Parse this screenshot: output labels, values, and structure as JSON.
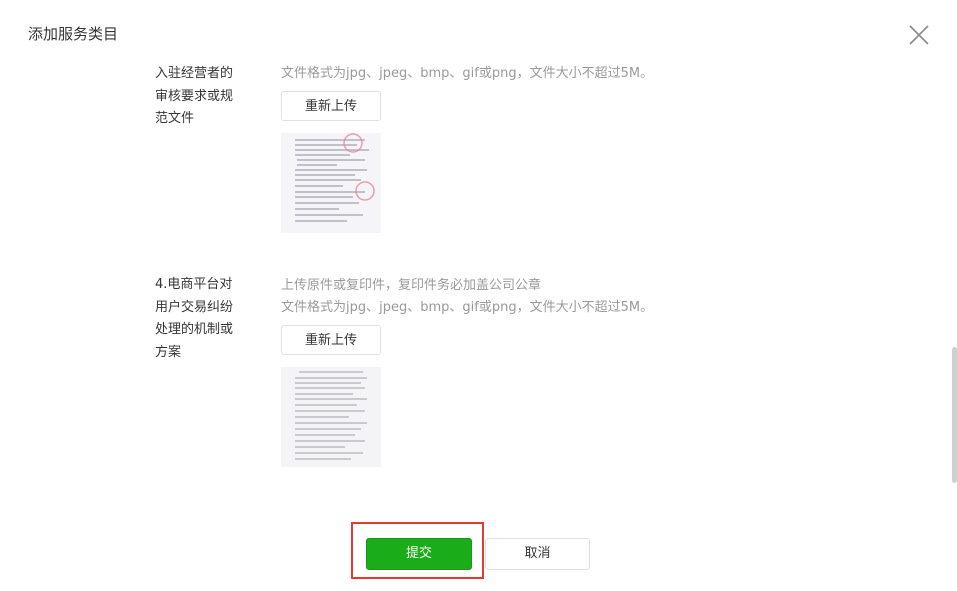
{
  "dialog": {
    "title": "添加服务类目",
    "close_icon": "close-icon"
  },
  "sections": [
    {
      "label_lines": [
        "入驻经营者的",
        "审核要求或规",
        "范文件"
      ],
      "hints": [
        "文件格式为jpg、jpeg、bmp、gif或png，文件大小不超过5M。"
      ],
      "reupload_label": "重新上传",
      "thumbnail": "document-thumbnail-with-red-seal"
    },
    {
      "label_lines": [
        "4.电商平台对",
        "用户交易纠纷",
        "处理的机制或",
        "方案"
      ],
      "hints": [
        "上传原件或复印件，复印件务必加盖公司公章",
        "文件格式为jpg、jpeg、bmp、gif或png，文件大小不超过5M。"
      ],
      "reupload_label": "重新上传",
      "thumbnail": "document-thumbnail"
    }
  ],
  "footer": {
    "submit_label": "提交",
    "cancel_label": "取消"
  },
  "colors": {
    "primary_green": "#1aad19",
    "highlight_red": "#e53935",
    "hint_gray": "#9a9a9a"
  }
}
